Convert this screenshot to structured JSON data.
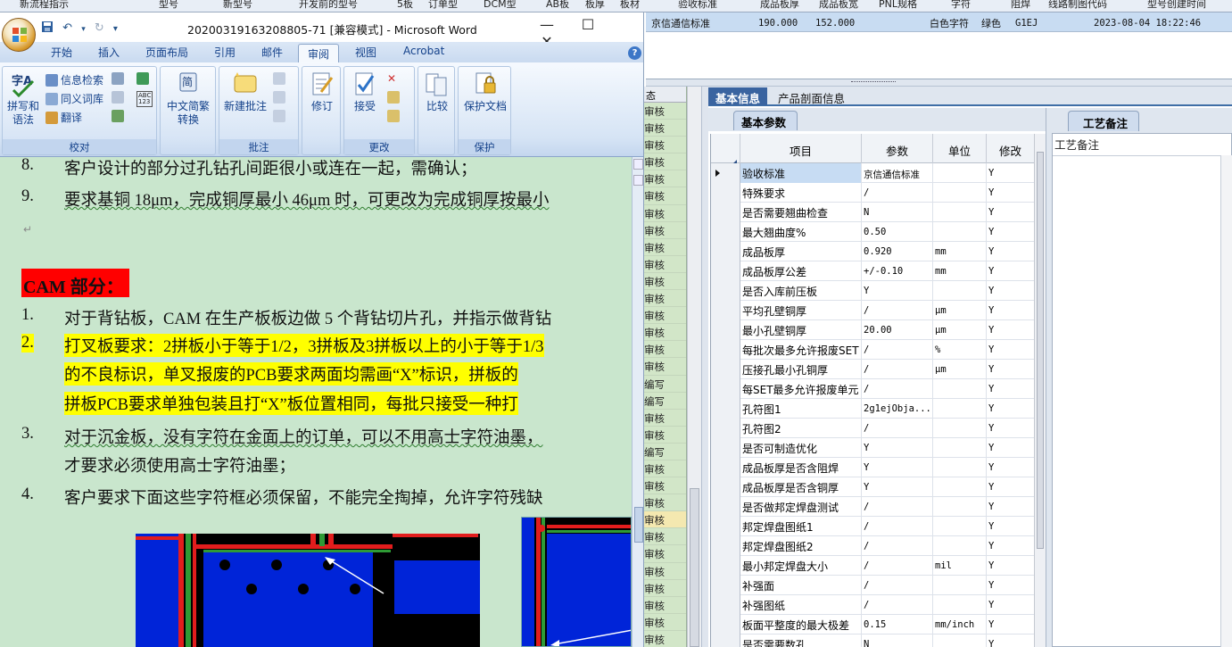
{
  "background_app": {
    "top_strip_labels": [
      "新流程指示",
      "型号",
      "新型号",
      "开发前的型号",
      "5板",
      "订单型",
      "DCM型",
      "AB板",
      "板厚",
      "板材",
      "验收标准",
      "成品板厚",
      "成品板宽",
      "PNL规格",
      "字符",
      "阻焊",
      "线路制图代码",
      "型号创建时间"
    ],
    "highlight_row": {
      "standard": "京信通信标准",
      "thickness": "190.000",
      "width": "152.000",
      "silk": "白色字符",
      "mask": "绿色",
      "code": "G1EJ",
      "created": "2023-08-04 18:22:46"
    },
    "status_column": {
      "header": "态",
      "cells": [
        "审核",
        "审核",
        "审核",
        "审核",
        "审核",
        "审核",
        "审核",
        "审核",
        "审核",
        "审核",
        "审核",
        "审核",
        "审核",
        "审核",
        "审核",
        "审核",
        "编写",
        "编写",
        "审核",
        "审核",
        "编写",
        "审核",
        "审核",
        "审核",
        "审核",
        "审核",
        "审核",
        "审核",
        "审核",
        "审核",
        "审核",
        "审核"
      ],
      "highlighted_index": 24
    },
    "tabs": [
      "基本信息",
      "产品剖面信息"
    ],
    "subtab": "基本参数",
    "grid": {
      "headers": [
        "项目",
        "参数",
        "单位",
        "修改"
      ],
      "rows": [
        {
          "item": "验收标准",
          "param": "京信通信标准",
          "unit": "",
          "mod": "Y"
        },
        {
          "item": "特殊要求",
          "param": "/",
          "unit": "",
          "mod": "Y"
        },
        {
          "item": "是否需要翘曲检查",
          "param": "N",
          "unit": "",
          "mod": "Y"
        },
        {
          "item": "最大翘曲度%",
          "param": "0.50",
          "unit": "",
          "mod": "Y"
        },
        {
          "item": "成品板厚",
          "param": "0.920",
          "unit": "mm",
          "mod": "Y"
        },
        {
          "item": "成品板厚公差",
          "param": "+/-0.10",
          "unit": "mm",
          "mod": "Y"
        },
        {
          "item": "是否入库前压板",
          "param": "Y",
          "unit": "",
          "mod": "Y"
        },
        {
          "item": "平均孔壁铜厚",
          "param": "/",
          "unit": "μm",
          "mod": "Y"
        },
        {
          "item": "最小孔壁铜厚",
          "param": "20.00",
          "unit": "μm",
          "mod": "Y"
        },
        {
          "item": "每批次最多允许报废SET",
          "param": "/",
          "unit": "%",
          "mod": "Y"
        },
        {
          "item": "压接孔最小孔铜厚",
          "param": "/",
          "unit": "μm",
          "mod": "Y"
        },
        {
          "item": "每SET最多允许报废单元",
          "param": "/",
          "unit": "",
          "mod": "Y"
        },
        {
          "item": "孔符图1",
          "param": "2g1ejObja...",
          "unit": "",
          "mod": "Y"
        },
        {
          "item": "孔符图2",
          "param": "/",
          "unit": "",
          "mod": "Y"
        },
        {
          "item": "是否可制造优化",
          "param": "Y",
          "unit": "",
          "mod": "Y"
        },
        {
          "item": "成品板厚是否含阻焊",
          "param": "Y",
          "unit": "",
          "mod": "Y"
        },
        {
          "item": "成品板厚是否含铜厚",
          "param": "Y",
          "unit": "",
          "mod": "Y"
        },
        {
          "item": "是否做邦定焊盘测试",
          "param": "/",
          "unit": "",
          "mod": "Y"
        },
        {
          "item": "邦定焊盘图纸1",
          "param": "/",
          "unit": "",
          "mod": "Y"
        },
        {
          "item": "邦定焊盘图纸2",
          "param": "/",
          "unit": "",
          "mod": "Y"
        },
        {
          "item": "最小邦定焊盘大小",
          "param": "/",
          "unit": "mil",
          "mod": "Y"
        },
        {
          "item": "补强面",
          "param": "/",
          "unit": "",
          "mod": "Y"
        },
        {
          "item": "补强图纸",
          "param": "/",
          "unit": "",
          "mod": "Y"
        },
        {
          "item": "板面平整度的最大极差",
          "param": "0.15",
          "unit": "mm/inch",
          "mod": "Y"
        },
        {
          "item": "是否需要数孔",
          "param": "N",
          "unit": "",
          "mod": "Y"
        }
      ]
    },
    "note_panel": {
      "tab": "工艺备注",
      "label": "工艺备注"
    }
  },
  "word": {
    "title": "20200319163208805-71 [兼容模式] - Microsoft Word",
    "window_buttons": [
      "—",
      "☐",
      "✕"
    ],
    "tabs": [
      "开始",
      "插入",
      "页面布局",
      "引用",
      "邮件",
      "审阅",
      "视图",
      "Acrobat"
    ],
    "active_tab": "审阅",
    "ribbon": {
      "proof": {
        "group": "校对",
        "spell": "拼写和语法",
        "research": "信息检索",
        "thesaurus": "同义词库",
        "translate": "翻译"
      },
      "chinese": {
        "group": "",
        "convert": "中文简繁转换"
      },
      "comments": {
        "group": "批注",
        "new": "新建批注"
      },
      "tracking": {
        "group": "",
        "track": "修订"
      },
      "changes": {
        "group": "更改",
        "accept": "接受"
      },
      "compare": {
        "group": "",
        "compare": "比较"
      },
      "protect": {
        "group": "保护",
        "protect": "保护文档"
      }
    },
    "doc": {
      "item8": {
        "num": "8.",
        "text": "客户设计的部分过孔钻孔间距很小或连在一起，需确认；"
      },
      "item9": {
        "num": "9.",
        "text": "要求基铜 18μm，完成铜厚最小 46μm 时，可更改为完成铜厚按最小"
      },
      "cam_heading": "CAM 部分：",
      "c1": {
        "num": "1.",
        "text": "对于背钻板，CAM 在生产板板边做 5 个背钻切片孔，并指示做背钻"
      },
      "c2": {
        "num": "2.",
        "line1": "打叉板要求：2拼板小于等于1/2，3拼板及3拼板以上的小于等于1/3",
        "line2": "的不良标识，单叉报废的PCB要求两面均需画“X”标识，拼板的",
        "line3": "拼板PCB要求单独包装且打“X”板位置相同，每批只接受一种打"
      },
      "c3": {
        "num": "3.",
        "line1": "对于沉金板，没有字符在金面上的订单，可以不用高士字符油墨，",
        "line2": "才要求必须使用高士字符油墨；"
      },
      "c4": {
        "num": "4.",
        "text": "客户要求下面这些字符框必须保留，不能完全掏掉，允许字符残缺"
      }
    }
  },
  "colors": {
    "word_doc_bg": "#c9e6cd",
    "highlight": "#ffff00",
    "cam_red": "#ff0000",
    "grid_selected": "#c7dcf3",
    "tab_active": "#3a64a0"
  }
}
